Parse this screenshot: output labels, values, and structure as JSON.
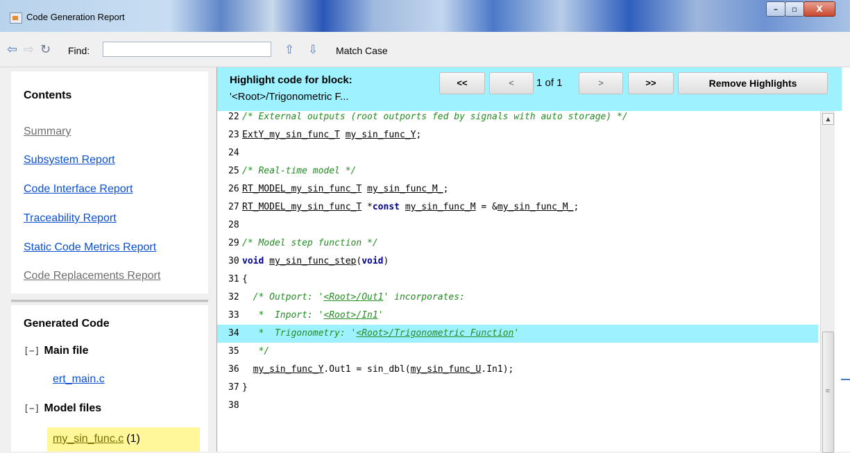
{
  "window": {
    "title": "Code Generation Report",
    "controls": {
      "minimize": "–",
      "maximize": "▫",
      "close": "X"
    }
  },
  "toolbar": {
    "find_label": "Find:",
    "find_value": "",
    "match_case_label": "Match Case",
    "icons": [
      "back-icon",
      "forward-icon",
      "refresh-icon",
      "find-previous-icon",
      "find-next-icon"
    ]
  },
  "contents": {
    "heading": "Contents",
    "links": [
      {
        "label": "Summary",
        "dimmed": true
      },
      {
        "label": "Subsystem Report",
        "dimmed": false
      },
      {
        "label": "Code Interface Report",
        "dimmed": false
      },
      {
        "label": "Traceability Report",
        "dimmed": false
      },
      {
        "label": "Static Code Metrics Report",
        "dimmed": false
      },
      {
        "label": "Code Replacements Report",
        "dimmed": true
      }
    ]
  },
  "generated_code": {
    "heading": "Generated Code",
    "groups": [
      {
        "toggle": "[−]",
        "name": "Main file",
        "files": [
          "ert_main.c"
        ]
      },
      {
        "toggle": "[−]",
        "name": "Model files",
        "files": [
          "my_sin_func.c"
        ],
        "selected_file": "my_sin_func.c",
        "selected_count": "(1)"
      }
    ]
  },
  "highlight": {
    "title": "Highlight code for block:",
    "block": "'<Root>/Trigonometric F...",
    "first": "<<",
    "prev": "<",
    "page": "1 of 1",
    "next": ">",
    "last": ">>",
    "remove": "Remove Highlights",
    "color": "#9ef2ff"
  },
  "code": {
    "lines": [
      {
        "n": "22",
        "t": "/* External outputs (root outports fed by signals with auto storage) */"
      },
      {
        "n": "23",
        "t": "ExtY_my_sin_func_T my_sin_func_Y;"
      },
      {
        "n": "24",
        "t": ""
      },
      {
        "n": "25",
        "t": "/* Real-time model */"
      },
      {
        "n": "26",
        "t": "RT_MODEL_my_sin_func_T my_sin_func_M_;"
      },
      {
        "n": "27",
        "t": "RT_MODEL_my_sin_func_T *const my_sin_func_M = &my_sin_func_M_;"
      },
      {
        "n": "28",
        "t": ""
      },
      {
        "n": "29",
        "t": "/* Model step function */"
      },
      {
        "n": "30",
        "t": "void my_sin_func_step(void)"
      },
      {
        "n": "31",
        "t": "{"
      },
      {
        "n": "32",
        "t": "  /* Outport: '<Root>/Out1' incorporates:"
      },
      {
        "n": "33",
        "t": "   *  Inport: '<Root>/In1'"
      },
      {
        "n": "34",
        "t": "   *  Trigonometry: '<Root>/Trigonometric Function'"
      },
      {
        "n": "35",
        "t": "   */"
      },
      {
        "n": "36",
        "t": "  my_sin_func_Y.Out1 = sin_dbl(my_sin_func_U.In1);"
      },
      {
        "n": "37",
        "t": "}"
      },
      {
        "n": "38",
        "t": ""
      }
    ],
    "highlighted_line": "34"
  },
  "scrollbar": {
    "grip": "≡",
    "up_arrow": "▲"
  }
}
